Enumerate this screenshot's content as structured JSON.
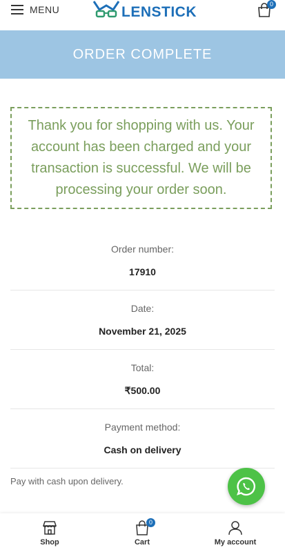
{
  "header": {
    "menu_label": "MENU",
    "logo_text": "LENSTICK",
    "cart_count": "0"
  },
  "banner": {
    "title": "ORDER COMPLETE"
  },
  "notice": {
    "message": "Thank you for shopping with us. Your account has been charged and your transaction is successful. We will be processing your order soon."
  },
  "order": {
    "number_label": "Order number:",
    "number": "17910",
    "date_label": "Date:",
    "date": "November 21, 2025",
    "total_label": "Total:",
    "total": "₹500.00",
    "payment_label": "Payment method:",
    "payment": "Cash on delivery"
  },
  "payment_note": "Pay with cash upon delivery.",
  "bottom_nav": {
    "shop": "Shop",
    "cart": "Cart",
    "cart_count": "0",
    "account": "My account"
  },
  "colors": {
    "brand_blue": "#1d6fb8",
    "banner_blue": "#9dc5e3",
    "notice_green": "#7a9e5c",
    "whatsapp_green": "#4dc247"
  }
}
